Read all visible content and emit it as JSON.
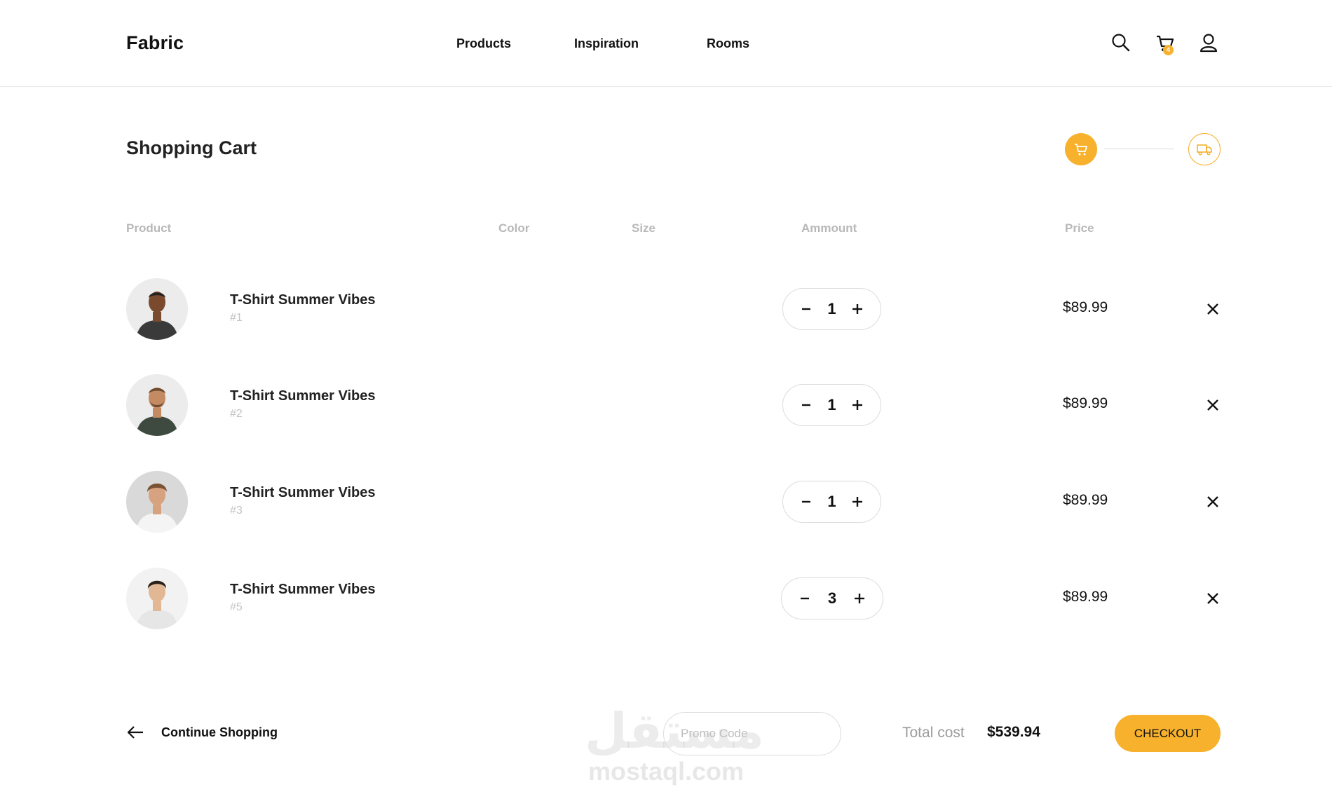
{
  "header": {
    "logo": "Fabric",
    "nav": [
      "Products",
      "Inspiration",
      "Rooms"
    ],
    "icons": [
      "search-icon",
      "cart-icon",
      "user-icon"
    ],
    "cart_count": "4"
  },
  "page": {
    "title": "Shopping Cart",
    "steps": [
      {
        "icon": "cart-icon",
        "state": "active"
      },
      {
        "icon": "truck-icon",
        "state": "inactive"
      }
    ]
  },
  "table": {
    "headers": [
      "Product",
      "Color",
      "Size",
      "Ammount",
      "Price"
    ],
    "items": [
      {
        "name": "T-Shirt Summer Vibes",
        "sku": "#1",
        "qty": "1",
        "price": "$89.99",
        "shirt": "#3a3a3a",
        "skin": "#7a4a2e"
      },
      {
        "name": "T-Shirt Summer Vibes",
        "sku": "#2",
        "qty": "1",
        "price": "$89.99",
        "shirt": "#3e4a40",
        "skin": "#c48b63"
      },
      {
        "name": "T-Shirt Summer Vibes",
        "sku": "#3",
        "qty": "1",
        "price": "$89.99",
        "shirt": "#f4f4f4",
        "skin": "#d7a27f"
      },
      {
        "name": "T-Shirt Summer Vibes",
        "sku": "#5",
        "qty": "3",
        "price": "$89.99",
        "shirt": "#e6e6e6",
        "skin": "#e2b793"
      }
    ]
  },
  "footer": {
    "continue_label": "Continue Shopping",
    "promo_placeholder": "Promo Code",
    "total_label": "Total cost",
    "total_value": "$539.94",
    "checkout_label": "CHECKOUT"
  },
  "watermark": {
    "arabic": "مستقل",
    "latin": "mostaql.com"
  },
  "colors": {
    "accent": "#f7b12d",
    "muted": "#b8b8b8",
    "text": "#111111"
  }
}
